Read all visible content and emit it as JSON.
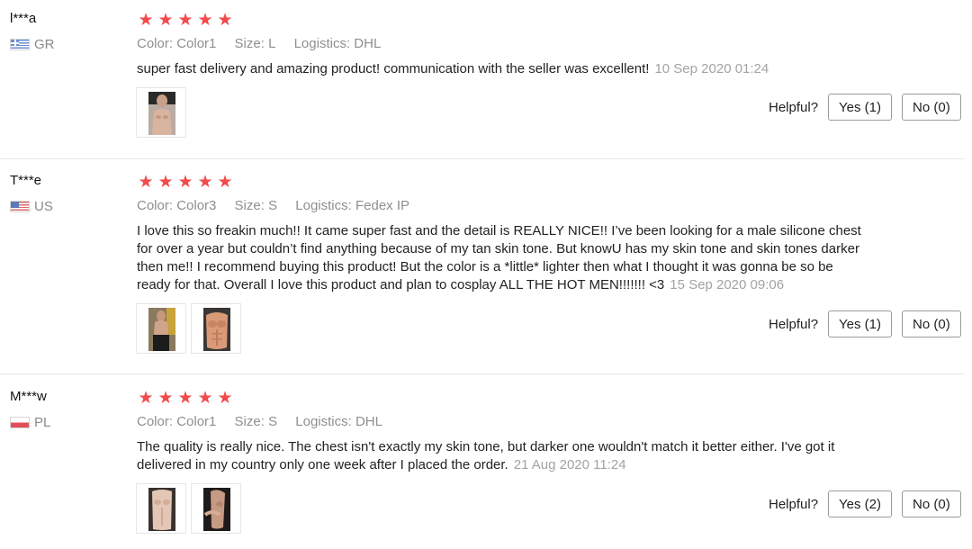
{
  "colors": {
    "star": "#f44a4a",
    "meta_text": "#8f8f8f",
    "date_text": "#a3a3a3"
  },
  "reviews": [
    {
      "user": "l***a",
      "country": "GR",
      "flag_icon": "greece-flag-icon",
      "stars": 5,
      "color_label": "Color:",
      "color_value": "Color1",
      "size_label": "Size:",
      "size_value": "L",
      "logistics_label": "Logistics:",
      "logistics_value": "DHL",
      "text": "super fast delivery and amazing product! communication with the seller was excellent!",
      "date": "10 Sep 2020 01:24",
      "images": [
        "review-photo"
      ],
      "helpful_label": "Helpful?",
      "yes_label": "Yes (1)",
      "no_label": "No (0)"
    },
    {
      "user": "T***e",
      "country": "US",
      "flag_icon": "usa-flag-icon",
      "stars": 5,
      "color_label": "Color:",
      "color_value": "Color3",
      "size_label": "Size:",
      "size_value": "S",
      "logistics_label": "Logistics:",
      "logistics_value": "Fedex IP",
      "text": "I love this so freakin much!! It came super fast and the detail is REALLY NICE!! I’ve been looking for a male silicone chest for over a year but couldn’t find anything because of my tan skin tone. But knowU has my skin tone and skin tones darker then me!! I recommend buying this product! But the color is a *little* lighter then what I thought it was gonna be so be ready for that. Overall I love this product and plan to cosplay ALL THE HOT MEN!!!!!!! <3",
      "date": "15 Sep 2020 09:06",
      "images": [
        "review-photo",
        "review-photo"
      ],
      "helpful_label": "Helpful?",
      "yes_label": "Yes (1)",
      "no_label": "No (0)"
    },
    {
      "user": "M***w",
      "country": "PL",
      "flag_icon": "poland-flag-icon",
      "stars": 5,
      "color_label": "Color:",
      "color_value": "Color1",
      "size_label": "Size:",
      "size_value": "S",
      "logistics_label": "Logistics:",
      "logistics_value": "DHL",
      "text": "The quality is really nice. The chest isn't exactly my skin tone, but darker one wouldn't match it better either. I've got it delivered in my country only one week after I placed the order.",
      "date": "21 Aug 2020 11:24",
      "images": [
        "review-photo",
        "review-photo"
      ],
      "helpful_label": "Helpful?",
      "yes_label": "Yes (2)",
      "no_label": "No (0)"
    }
  ]
}
